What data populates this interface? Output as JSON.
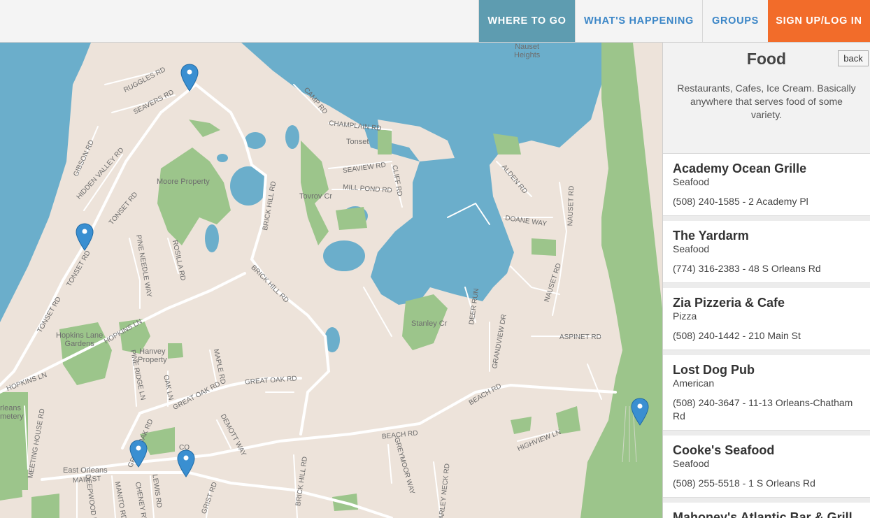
{
  "nav": {
    "where_to_go": "WHERE TO GO",
    "whats_happening": "WHAT'S HAPPENING",
    "groups": "GROUPS",
    "signup_login": "SIGN UP/LOG IN"
  },
  "map": {
    "places": {
      "nauset_heights": "Nauset\nHeights",
      "tonset": "Tonset",
      "moore_property": "Moore Property",
      "tovrov_cr": "Tovrov Cr",
      "stanley_cr": "Stanley Cr",
      "hopkins_lane_gardens": "Hopkins Lane\nGardens",
      "hanvey_property": "Hanvey\nProperty",
      "east_orleans": "East Orleans",
      "orleans_cemetery": "rleans\nmetery"
    },
    "roads": {
      "ruggles": "RUGGLES RD",
      "seavers": "SEAVERS RD",
      "gibson": "GIBSON RD",
      "hidden_valley": "HIDDEN VALLEY RD",
      "tonset_rd_1": "TONSET RD",
      "tonset_rd_2": "TONSET RD",
      "tonset_rd_3": "TONSET RD",
      "camp": "CAMP RD",
      "champlain": "CHAMPLAIN RD",
      "seaview": "SEAVIEW RD",
      "mill_pond": "MILL POND RD",
      "cliff": "CLIFF RD",
      "alden": "ALDEN RD",
      "doane_way": "DOANE WAY",
      "nauset_rd_1": "NAUSET RD",
      "nauset_rd_2": "NAUSET RD",
      "brick_hill_1": "BRICK HILL RD",
      "brick_hill_2": "BRICK HILL RD",
      "brick_hill_3": "BRICK HILL RD",
      "pine_needle": "PINE NEEDLE WAY",
      "rosilla": "ROSILLA RD",
      "hopkins_ln_1": "HOPKINS LN",
      "hopkins_ln_2": "HOPKINS LN",
      "deer_run": "DEER RUN",
      "grandview": "GRANDVIEW DR",
      "aspinet": "ASPINET RD",
      "pine_ridge": "PINE RIDGE LN",
      "maple": "MAPLE RD",
      "oak_ln": "OAK LN",
      "great_oak_1": "GREAT OAK RD",
      "great_oak_2": "GREAT OAK RD",
      "great_oak_3": "GREAT OAK RD",
      "beach_1": "BEACH RD",
      "beach_2": "BEACH RD",
      "highview": "HIGHVIEW LN",
      "demott": "DEMOTT WAY",
      "meeting_house": "MEETING HOUSE RD",
      "main_st": "MAIN ST",
      "manito": "MANITO RD",
      "cheney": "CHENEY RD",
      "lewis": "LEWIS RD",
      "grist": "GRIST RD",
      "greymoor": "GREYMOOR WAY",
      "barley_neck": "BARLEY NECK RD",
      "deepwood": "DEEPWOOD DR",
      "co": "CO"
    }
  },
  "panel": {
    "title": "Food",
    "back_label": "back",
    "description": "Restaurants, Cafes, Ice Cream. Basically anywhere that serves food of some variety."
  },
  "listings": [
    {
      "name": "Academy Ocean Grille",
      "type": "Seafood",
      "info": "(508) 240-1585 - 2 Academy Pl"
    },
    {
      "name": "The Yardarm",
      "type": "Seafood",
      "info": "(774) 316-2383 - 48 S Orleans Rd"
    },
    {
      "name": "Zia Pizzeria & Cafe",
      "type": "Pizza",
      "info": "(508) 240-1442 - 210 Main St"
    },
    {
      "name": "Lost Dog Pub",
      "type": "American",
      "info": "(508) 240-3647 - 11-13 Orleans-Chatham Rd"
    },
    {
      "name": "Cooke's Seafood",
      "type": "Seafood",
      "info": "(508) 255-5518 - 1 S Orleans Rd"
    },
    {
      "name": "Mahoney's Atlantic Bar & Grill",
      "type": "",
      "info": ""
    }
  ],
  "colors": {
    "nav_active": "#5e9cb0",
    "nav_link": "#3b86c7",
    "signup": "#f26c2a",
    "water": "#6baecb",
    "park": "#9cc58b",
    "land": "#ede3da",
    "pin": "#3a8fd1"
  },
  "icons": {
    "map_pin": "map-pin-icon"
  }
}
